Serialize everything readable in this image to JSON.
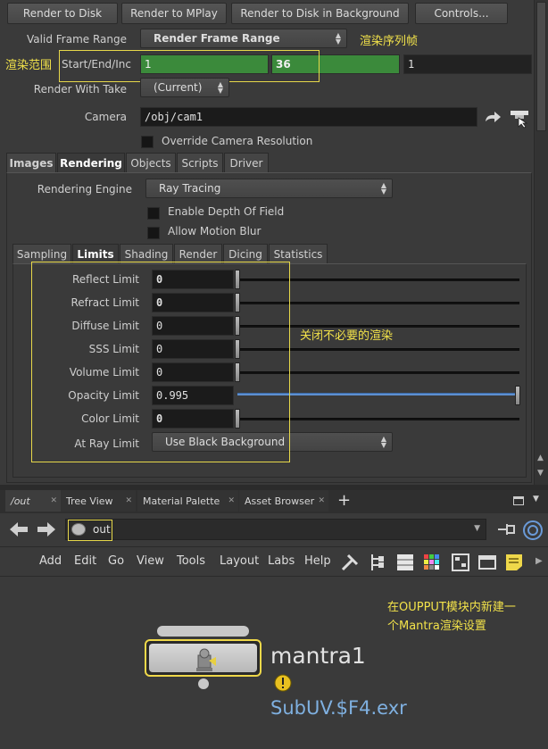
{
  "top_buttons": [
    "Render to Disk",
    "Render to MPlay",
    "Render to Disk in Background",
    "Controls..."
  ],
  "params": {
    "valid_frame_range_label": "Valid Frame Range",
    "valid_frame_range_value": "Render Frame Range",
    "start_end_inc_label": "Start/End/Inc",
    "start": "1",
    "end": "36",
    "inc": "1",
    "render_with_take_label": "Render With Take",
    "render_with_take_value": "(Current)",
    "camera_label": "Camera",
    "camera_value": "/obj/cam1",
    "override_cam_label": "Override Camera Resolution"
  },
  "main_tabs": [
    "Images",
    "Rendering",
    "Objects",
    "Scripts",
    "Driver"
  ],
  "rendering": {
    "engine_label": "Rendering Engine",
    "engine_value": "Ray Tracing",
    "dof_label": "Enable Depth Of Field",
    "motion_blur_label": "Allow Motion Blur"
  },
  "sub_tabs": [
    "Sampling",
    "Limits",
    "Shading",
    "Render",
    "Dicing",
    "Statistics"
  ],
  "limits": [
    {
      "label": "Reflect Limit",
      "value": "0",
      "fraction": 0
    },
    {
      "label": "Refract Limit",
      "value": "0",
      "fraction": 0
    },
    {
      "label": "Diffuse Limit",
      "value": "0",
      "fraction": 0
    },
    {
      "label": "SSS Limit",
      "value": "0",
      "fraction": 0
    },
    {
      "label": "Volume Limit",
      "value": "0",
      "fraction": 0
    },
    {
      "label": "Opacity Limit",
      "value": "0.995",
      "fraction": 0.995
    },
    {
      "label": "Color Limit",
      "value": "0",
      "fraction": 0
    }
  ],
  "at_ray_limit": {
    "label": "At Ray Limit",
    "value": "Use Black Background"
  },
  "annotations": {
    "frame_seq": "渲染序列帧",
    "render_range": "渲染范围",
    "disable_render": "关闭不必要的渲染",
    "new_mantra_line1": "在OUPPUT模块内新建一",
    "new_mantra_line2": "个Mantra渲染设置"
  },
  "pane_tabs": [
    "/out",
    "Tree View",
    "Material Palette",
    "Asset Browser"
  ],
  "path_value": "out",
  "network_menu": [
    "Add",
    "Edit",
    "Go",
    "View",
    "Tools",
    "Layout",
    "Labs",
    "Help"
  ],
  "node": {
    "name": "mantra1",
    "output": "SubUV.$F4.exr"
  },
  "colors": {
    "accent_yellow": "#e7d84a",
    "node_name_blue": "#7fb0e0",
    "field_green": "#3b8a3b"
  }
}
